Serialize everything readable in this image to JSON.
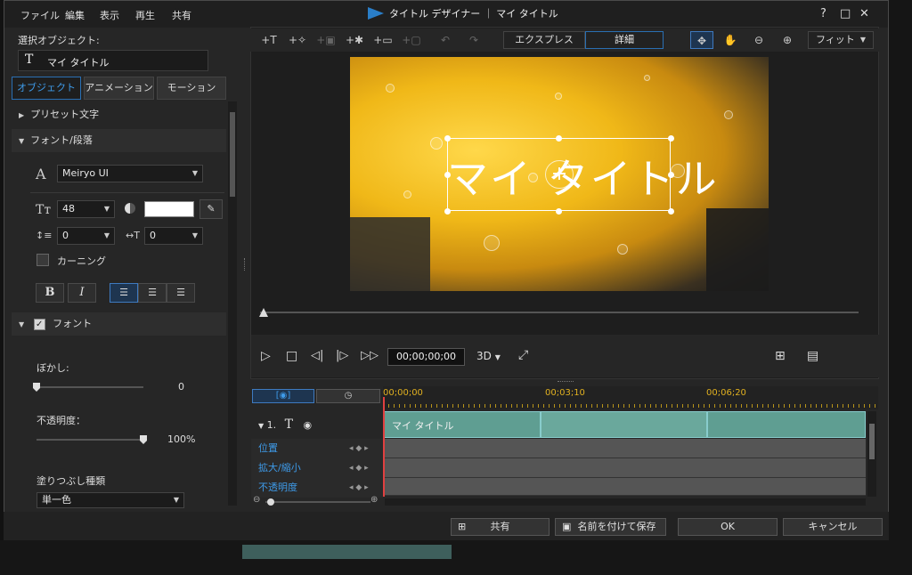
{
  "menu": {
    "items": [
      "ファイル",
      "編集",
      "表示",
      "再生",
      "共有"
    ]
  },
  "window": {
    "title": "タイトル デザイナー ｜ マイ タイトル",
    "help": "?",
    "maximize": "□",
    "close": "✕"
  },
  "left": {
    "selected_object_label": "選択オブジェクト:",
    "selected_object_value": "マイ タイトル",
    "tabs": [
      "オブジェクト",
      "アニメーション",
      "モーション"
    ],
    "sections": {
      "preset": "プリセット文字",
      "font_para": "フォント/段落",
      "font_effect": "フォント"
    },
    "font_name": "Meiryo UI",
    "font_size": "48",
    "line_spacing": "0",
    "char_spacing": "0",
    "kerning": "カーニング",
    "bold": "B",
    "italic": "I",
    "blur_label": "ぼかし:",
    "blur_value": "0",
    "opacity_label": "不透明度：",
    "opacity_value": "100%",
    "fill_type_label": "塗りつぶし種類",
    "fill_type_value": "単一色",
    "blur_level": 0,
    "opacity_level": 1.0
  },
  "toolbar": {
    "express": "エクスプレス",
    "advanced": "詳細",
    "fit": "フィット"
  },
  "preview": {
    "title_text": "マイ タイトル"
  },
  "player": {
    "timecode": "00;00;00;00",
    "mode_3d": "3D"
  },
  "timeline": {
    "marks": [
      "00;00;00",
      "00;03;10",
      "00;06;20"
    ],
    "track_name": "1.",
    "clip_label": "マイ タイトル",
    "rows": [
      "位置",
      "拡大/縮小",
      "不透明度"
    ]
  },
  "buttons": {
    "share": "共有",
    "save_as": "名前を付けて保存",
    "ok": "OK",
    "cancel": "キャンセル"
  },
  "colors": {
    "accent": "#3e9ae8",
    "clip": "#5f9e92",
    "playhead": "#e04040"
  }
}
